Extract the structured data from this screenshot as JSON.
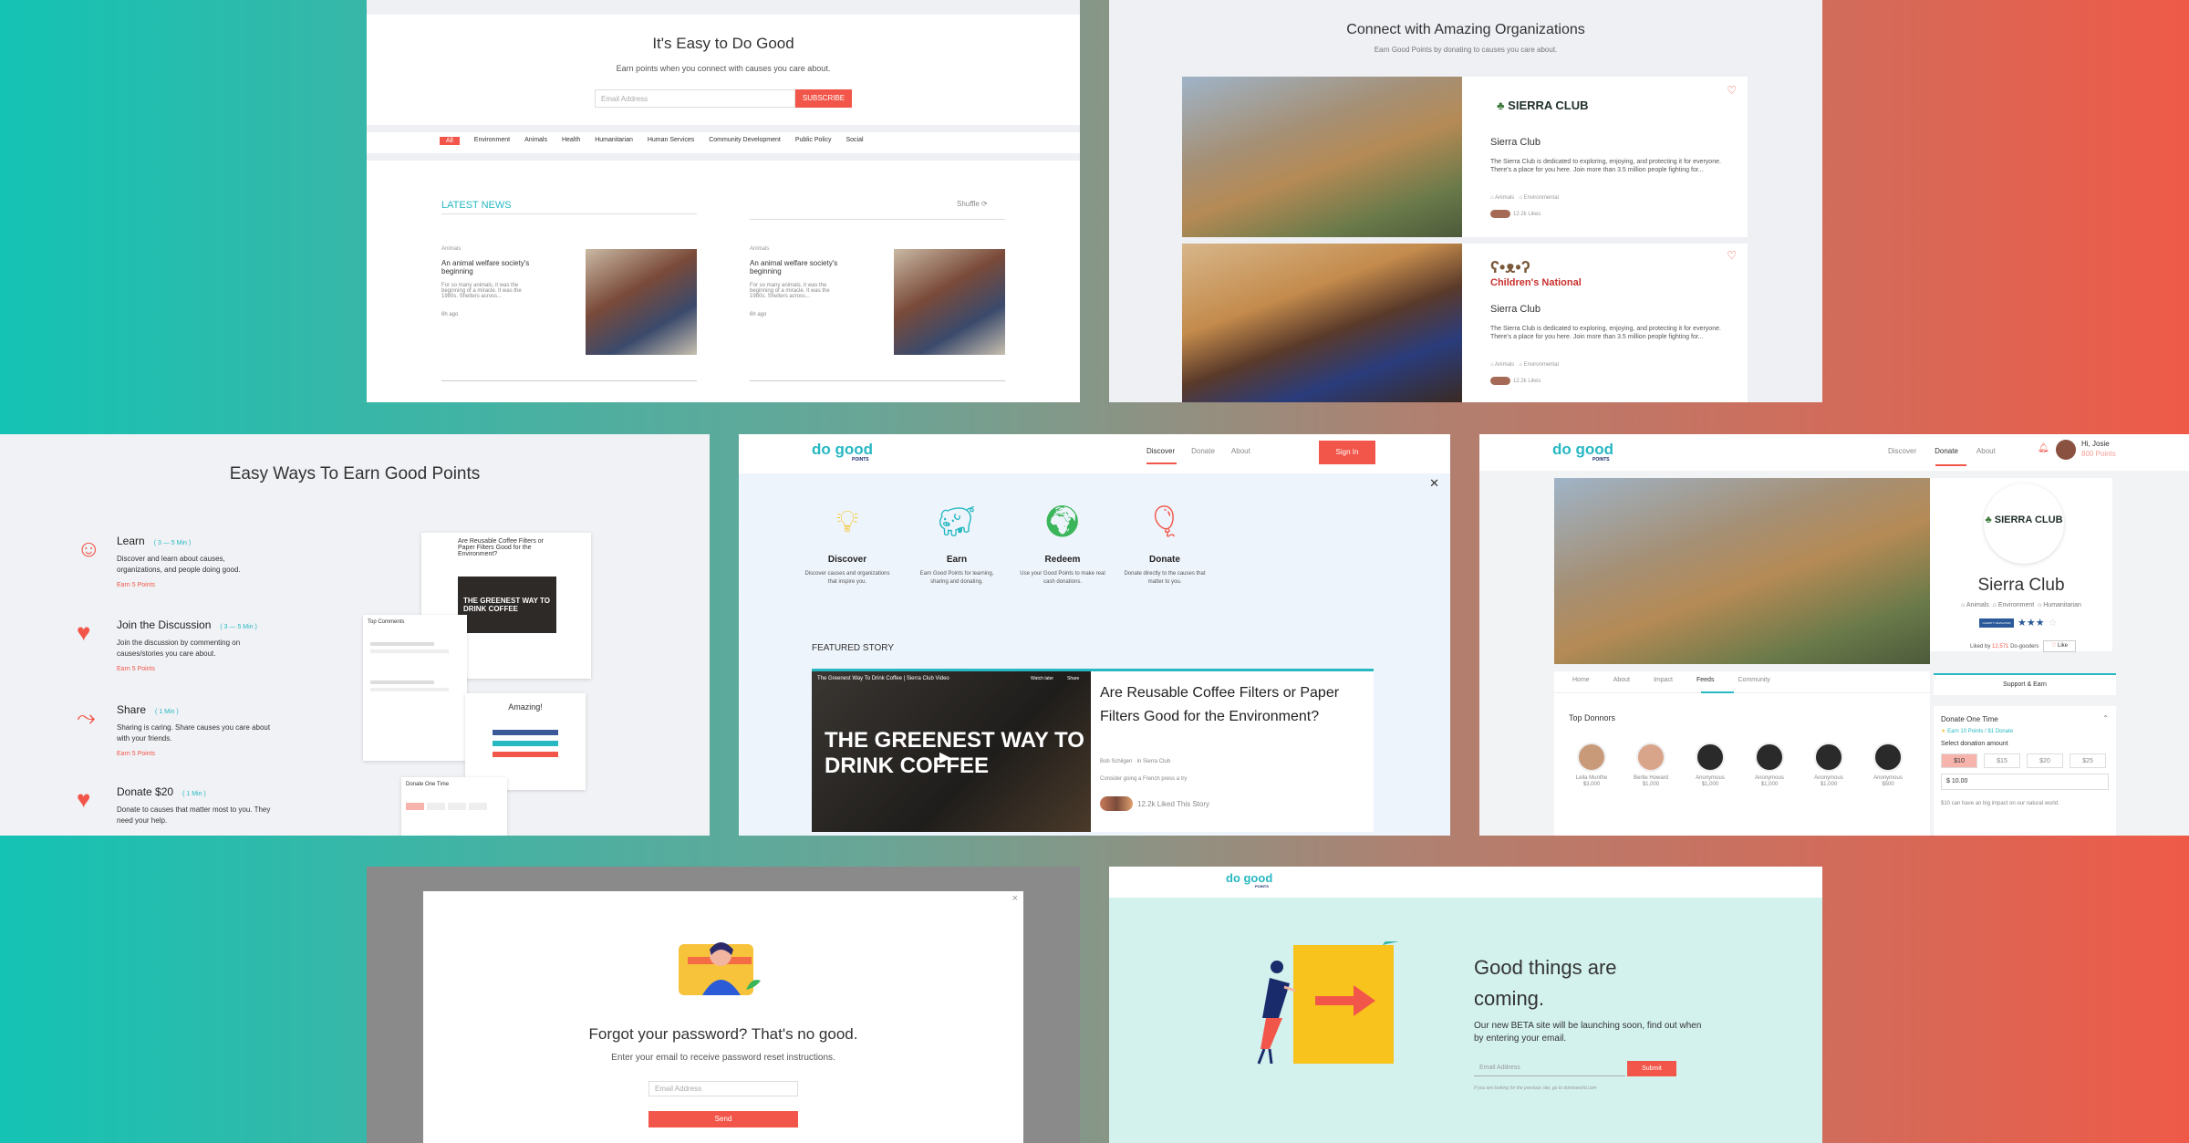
{
  "p1": {
    "title": "It's Easy to Do Good",
    "subtitle": "Earn points when you connect with causes you care about.",
    "email_placeholder": "Email Address",
    "subscribe": "SUBSCRIBE",
    "categories": [
      "All",
      "Environment",
      "Animals",
      "Health",
      "Humanitarian",
      "Human Services",
      "Community Development",
      "Public Policy",
      "Social"
    ],
    "latest_news": "LATEST NEWS",
    "shuffle": "Shuffle",
    "news": [
      {
        "tag": "Animals",
        "title": "An animal welfare society's beginning",
        "body": "For so many animals, it was the beginning of a miracle. It was the 1980s. Shelters across...",
        "time": "6h ago"
      },
      {
        "tag": "Animals",
        "title": "An animal welfare society's beginning",
        "body": "For so many animals, it was the beginning of a miracle. It was the 1980s. Shelters across...",
        "time": "6h ago"
      }
    ]
  },
  "p2": {
    "title": "Connect with Amazing Organizations",
    "subtitle": "Earn Good Points by donating to causes you care about.",
    "orgs": [
      {
        "logo": "SIERRA CLUB",
        "name": "Sierra Club",
        "desc": "The Sierra Club is dedicated to exploring, enjoying, and protecting it for everyone. There's a place for you here. Join more than 3.5 million people fighting for...",
        "tags": [
          "Animals",
          "Environmental"
        ],
        "likes": "12.2k Likes"
      },
      {
        "logo": "Children's National",
        "name": "Sierra Club",
        "desc": "The Sierra Club is dedicated to exploring, enjoying, and protecting it for everyone. There's a place for you here. Join more than 3.5 million people fighting for...",
        "tags": [
          "Animals",
          "Environmental"
        ],
        "likes": "12.2k Likes"
      }
    ]
  },
  "p3": {
    "title": "Easy Ways To Earn Good Points",
    "items": [
      {
        "name": "Learn",
        "time": "( 3 — 5 Min )",
        "desc": "Discover and learn about causes, organizations, and people doing good.",
        "points": "Earn 5 Points"
      },
      {
        "name": "Join the Discussion",
        "time": "( 3 — 5 Min )",
        "desc": "Join the discussion by commenting on causes/stories you care about.",
        "points": "Earn 5 Points"
      },
      {
        "name": "Share",
        "time": "( 1 Min )",
        "desc": "Sharing is caring. Share causes you care about with your friends.",
        "points": "Earn 5 Points"
      },
      {
        "name": "Donate $20",
        "time": "( 1 Min )",
        "desc": "Donate to causes that matter most to you. They need your help.",
        "points": ""
      }
    ],
    "mock_article": "Are Reusable Coffee Filters or Paper Filters Good for the Environment?",
    "mock_video": "THE GREENEST WAY TO DRINK COFFEE",
    "top_comments": "Top Comments",
    "amazing": "Amazing!",
    "donate_one_time": "Donate One Time"
  },
  "p4": {
    "logo_main": "do good",
    "logo_sub": "POINTS",
    "nav": [
      "Discover",
      "Donate",
      "About"
    ],
    "signin": "Sign In",
    "close": "✕",
    "features": [
      {
        "name": "Discover",
        "desc": "Discover causes and organizations that inspire you."
      },
      {
        "name": "Earn",
        "desc": "Earn Good Points for learning, sharing and donating."
      },
      {
        "name": "Redeem",
        "desc": "Use your Good Points to make real cash donations."
      },
      {
        "name": "Donate",
        "desc": "Donate directly to the causes that matter to you."
      }
    ],
    "featured_label": "FEATURED STORY",
    "video_title": "The Greenest Way To Drink Coffee | Sierra Club Video",
    "video_watch_later": "Watch later",
    "video_share": "Share",
    "video_overlay": "THE GREENEST WAY TO DRINK COFFEE",
    "story_title": "Are Reusable Coffee Filters or Paper Filters Good for the Environment?",
    "story_author": "Bob Schilgen · in Sierra Club",
    "story_teaser": "Consider going a French press a try",
    "story_likes": "12.2k Liked This Story"
  },
  "p5": {
    "logo_main": "do good",
    "logo_sub": "POINTS",
    "nav": [
      "Discover",
      "Donate",
      "About"
    ],
    "greeting": "Hi, Josie",
    "points": "800 Points",
    "org_logo": "SIERRA CLUB",
    "org_name": "Sierra Club",
    "tags": [
      "Animals",
      "Environment",
      "Humanitarian"
    ],
    "rating_label": "CHARITY NAVIGATOR",
    "liked_by_prefix": "Liked by",
    "liked_by_count": "12,571",
    "liked_by_suffix": "Do-gooders",
    "like": "Like",
    "tabs": [
      "Home",
      "About",
      "Impact",
      "Feeds",
      "Community"
    ],
    "support_earn": "Support & Earn",
    "top_donors": "Top Donnors",
    "donors": [
      {
        "name": "Leila Munthe",
        "amount": "$3,000"
      },
      {
        "name": "Bertie Howard",
        "amount": "$1,000"
      },
      {
        "name": "Anonymous",
        "amount": "$1,000"
      },
      {
        "name": "Anonymous",
        "amount": "$1,000"
      },
      {
        "name": "Anonymous",
        "amount": "$1,000"
      },
      {
        "name": "Anonymous",
        "amount": "$500"
      }
    ],
    "donate_one_time": "Donate One Time",
    "earn_info": "Earn 10 Points / $1 Donate",
    "select_amount": "Select donation amount",
    "amounts": [
      "$10",
      "$15",
      "$20",
      "$25"
    ],
    "amount_value": "$ 10.00",
    "impact_note": "$10 can have an big impact on our natural world."
  },
  "p6": {
    "close": "×",
    "title": "Forgot your password? That's no good.",
    "subtitle": "Enter your email to receive password reset instructions.",
    "email_placeholder": "Email Address",
    "send": "Send"
  },
  "p7": {
    "logo_main": "do good",
    "logo_sub": "POINTS",
    "title_line1": "Good things are",
    "title_line2": "coming.",
    "desc": "Our new BETA site will be launching soon, find out when by entering your email.",
    "email_placeholder": "Email Address",
    "submit": "Submit",
    "footnote": "If you are looking for the previous site, go to dointsworld.com"
  },
  "colors": {
    "accent": "#f2564a",
    "teal": "#27b8c2",
    "navy": "#1a2b6b"
  }
}
